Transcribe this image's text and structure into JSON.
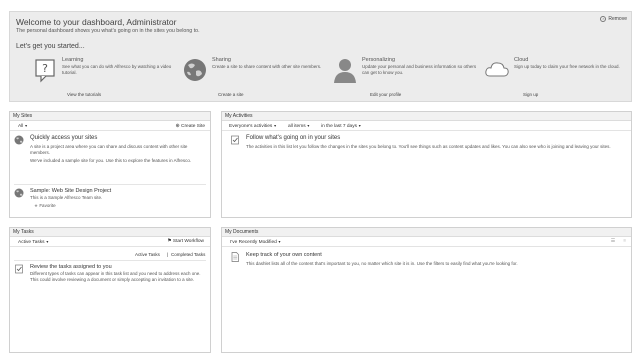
{
  "welcome": {
    "title": "Welcome to your dashboard, Administrator",
    "subtitle": "The personal dashboard shows you what's going on in the sites you belong to.",
    "started": "Let's get you started...",
    "remove_label": "Remove",
    "features": [
      {
        "title": "Learning",
        "desc": "See what you can do with Alfresco by watching a video tutorial.",
        "link": "View the tutorials",
        "icon": "question-icon"
      },
      {
        "title": "Sharing",
        "desc": "Create a site to share content with other site members.",
        "link": "Create a site",
        "icon": "globe-icon"
      },
      {
        "title": "Personalizing",
        "desc": "Update your personal and business information so others can get to know you.",
        "link": "Edit your profile",
        "icon": "person-icon"
      },
      {
        "title": "Cloud",
        "desc": "Sign up today to claim your free network in the cloud.",
        "link": "Sign up",
        "icon": "cloud-icon"
      }
    ]
  },
  "my_sites": {
    "title": "My Sites",
    "filter": "All",
    "create_site": "Create Site",
    "intro_title": "Quickly access your sites",
    "intro_text_1": "A site is a project area where you can share and discuss content with other site members.",
    "intro_text_2": "We've included a sample site for you. Use this to explore the features in Alfresco.",
    "sample_title": "Sample: Web Site Design Project",
    "sample_desc": "This is a Sample Alfresco Team site.",
    "favorite": "Favorite"
  },
  "my_activities": {
    "title": "My Activities",
    "filter_1": "Everyone's activities",
    "filter_2": "all items",
    "filter_3": "in the last 7 days",
    "intro_title": "Follow what's going on in your sites",
    "intro_text": "The activities in this list let you follow the changes in the sites you belong to. You'll see things such as content updates and likes. You can also see who is joining and leaving your sites."
  },
  "my_tasks": {
    "title": "My Tasks",
    "filter": "Active Tasks",
    "start_workflow": "Start Workflow",
    "link_active": "Active Tasks",
    "link_separator": "|",
    "link_completed": "Completed Tasks",
    "intro_title": "Review the tasks assigned to you",
    "intro_text": "Different types of tasks can appear in this task list and you need to address each one. This could involve reviewing a document or simply accepting an invitation to a site."
  },
  "my_documents": {
    "title": "My Documents",
    "filter": "I've Recently Modified",
    "intro_title": "Keep track of your own content",
    "intro_text": "This dashlet lists all of the content that's important to you, no matter which site it is in. Use the filters to easily find what you're looking for."
  },
  "colors": {
    "banner_bg": "#ececec",
    "title_bar_bg": "#f1f1f1"
  }
}
